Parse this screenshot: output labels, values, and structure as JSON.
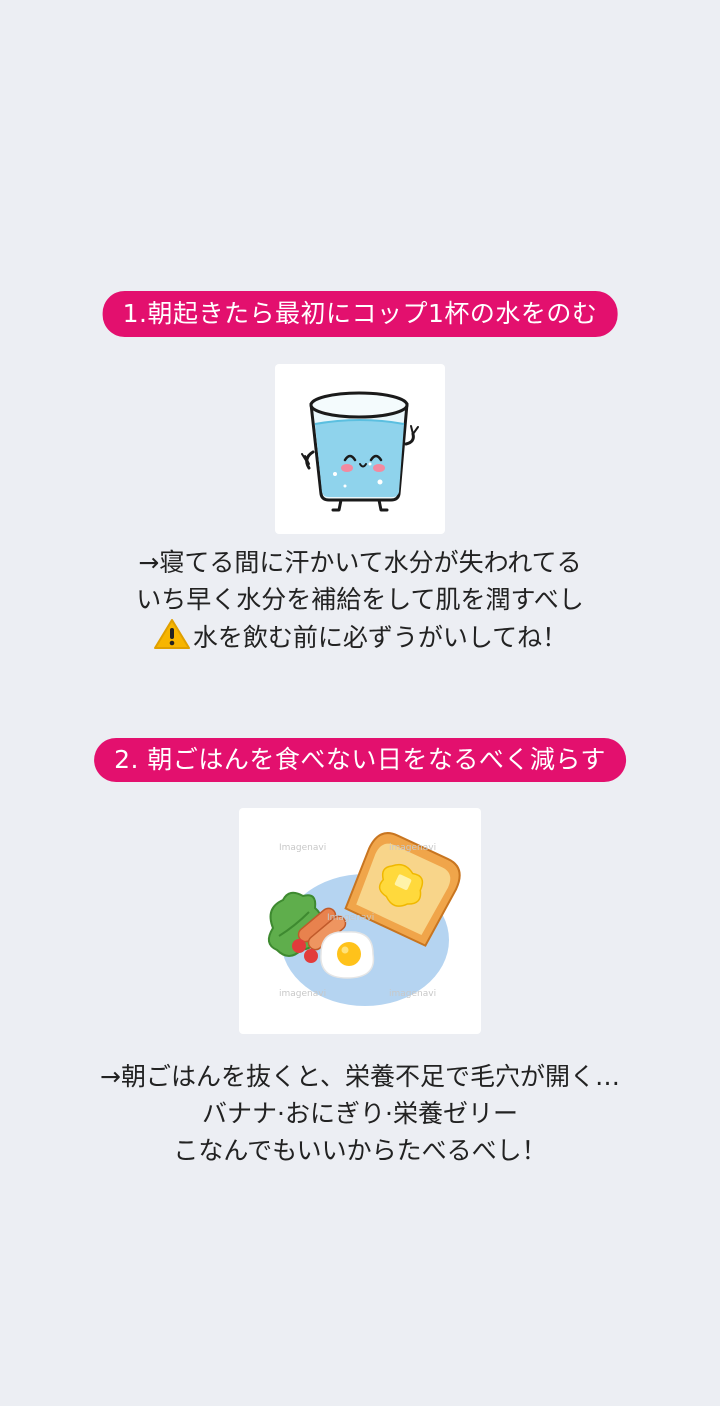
{
  "sections": [
    {
      "heading": "1.朝起きたら最初にコップ1杯の水をのむ",
      "image_icon": "water-glass-character-icon",
      "lines": [
        "→寝てる間に汗かいて水分が失われてる",
        "いち早く水分を補給をして肌を潤すべし",
        "水を飲む前に必ずうがいしてね！"
      ],
      "warning_icon": "warning-icon"
    },
    {
      "heading": "2. 朝ごはんを食べない日をなるべく減らす",
      "image_icon": "breakfast-plate-icon",
      "watermarks": [
        "Imagenavi",
        "imagenavi",
        "Imagenavi",
        "imagenavi",
        "imagenavi"
      ],
      "lines": [
        "→朝ごはんを抜くと、栄養不足で毛穴が開く…",
        "バナナ·おにぎり·栄養ゼリー",
        "こなんでもいいからたべるべし！"
      ]
    }
  ],
  "colors": {
    "background": "#eceef3",
    "accent": "#e3106e",
    "text": "#222222"
  }
}
